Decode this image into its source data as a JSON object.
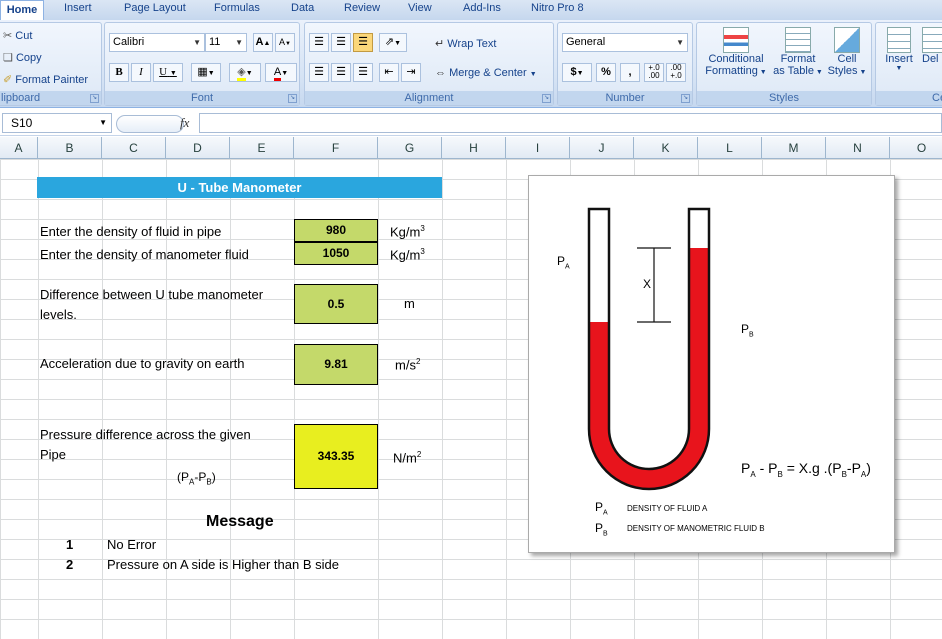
{
  "ribbon": {
    "tabs": [
      "Home",
      "Insert",
      "Page Layout",
      "Formulas",
      "Data",
      "Review",
      "View",
      "Add-Ins",
      "Nitro Pro 8"
    ],
    "clipboard": {
      "cut": "Cut",
      "copy": "Copy",
      "format_painter": "Format Painter",
      "label": "lipboard"
    },
    "font": {
      "name": "Calibri",
      "size": "11",
      "grow": "A",
      "shrink": "A",
      "bold": "B",
      "italic": "I",
      "underline": "U",
      "font_color_letter": "A",
      "label": "Font"
    },
    "alignment": {
      "wrap_text": "Wrap Text",
      "merge_center": "Merge & Center",
      "label": "Alignment"
    },
    "number": {
      "format": "General",
      "currency": "$",
      "percent": "%",
      "comma": ",",
      "inc_decimal": "+.0 .00",
      "dec_decimal": ".00 +.0",
      "label": "Number"
    },
    "styles": {
      "conditional_1": "Conditional",
      "conditional_2": "Formatting",
      "format_table_1": "Format",
      "format_table_2": "as Table",
      "cell_styles_1": "Cell",
      "cell_styles_2": "Styles",
      "label": "Styles"
    },
    "cells": {
      "insert": "Insert",
      "delete": "Del",
      "label": "Ce"
    }
  },
  "formula_bar": {
    "name_box": "S10",
    "fx": "fx",
    "formula": ""
  },
  "columns": [
    "A",
    "B",
    "C",
    "D",
    "E",
    "F",
    "G",
    "H",
    "I",
    "J",
    "K",
    "L",
    "M",
    "N",
    "O"
  ],
  "sheet": {
    "title": "U - Tube Manometer",
    "density_pipe_label": "Enter the density of fluid in pipe",
    "density_pipe_value": "980",
    "density_pipe_unit": "Kg/m",
    "density_mano_label": "Enter the density of  manometer fluid",
    "density_mano_value": "1050",
    "density_mano_unit": "Kg/m",
    "unit_exp_3": "3",
    "diff_label_1": "Difference between U tube manometer",
    "diff_label_2": "levels.",
    "diff_value": "0.5",
    "diff_unit": "m",
    "gravity_label": "Acceleration due to gravity on earth",
    "gravity_value": "9.81",
    "gravity_unit": "m/s",
    "unit_exp_2": "2",
    "pressure_label_1": "Pressure difference across the given",
    "pressure_label_2": "Pipe",
    "pressure_sub_p": "(P",
    "pressure_sub_a": "A",
    "pressure_sub_dash": "-P",
    "pressure_sub_b": "B",
    "pressure_sub_close": ")",
    "pressure_value": "343.35",
    "pressure_unit": "N/m",
    "message_header": "Message",
    "messages": [
      {
        "num": "1",
        "text": "No Error"
      },
      {
        "num": "2",
        "text": "Pressure on A side is Higher than B side"
      }
    ]
  },
  "figure": {
    "pa": "P",
    "pa_sub": "A",
    "pb": "P",
    "pb_sub": "B",
    "x": "X",
    "formula": "P",
    "formula_a": "A",
    "formula_mid": " - P",
    "formula_b": "B",
    "formula_rest": " = X.g .(P",
    "formula_b2": "B",
    "formula_end": "-P",
    "formula_a2": "A",
    "formula_close": ")",
    "legend_a_sym": "P",
    "legend_a_sub": "A",
    "legend_a_text": "DENSITY OF FLUID A",
    "legend_b_sym": "P",
    "legend_b_sub": "B",
    "legend_b_text": "DENSITY OF MANOMETRIC FLUID B"
  },
  "colors": {
    "title_bg": "#2aa6de",
    "input_bg": "#c4d96a",
    "result_bg": "#e8ee1f",
    "fluid": "#e8141c"
  }
}
